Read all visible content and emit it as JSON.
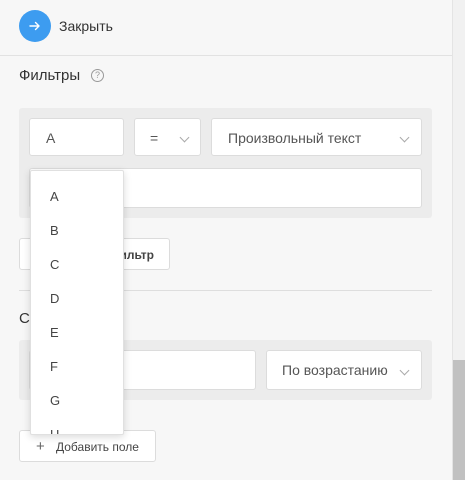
{
  "header": {
    "close_label": "Закрыть"
  },
  "filters": {
    "title": "Фильтры",
    "field_value": "A",
    "operator_value": "=",
    "type_value": "Произвольный текст",
    "text_value": "",
    "add_filter_label": "ильтр",
    "dropdown_options": [
      "A",
      "B",
      "C",
      "D",
      "E",
      "F",
      "G",
      "H"
    ]
  },
  "sort": {
    "title": "С",
    "field_value": "",
    "order_value": "По возрастанию",
    "add_field_label": "Добавить поле"
  },
  "colors": {
    "accent": "#3d9cf0",
    "panel": "#ececec"
  }
}
